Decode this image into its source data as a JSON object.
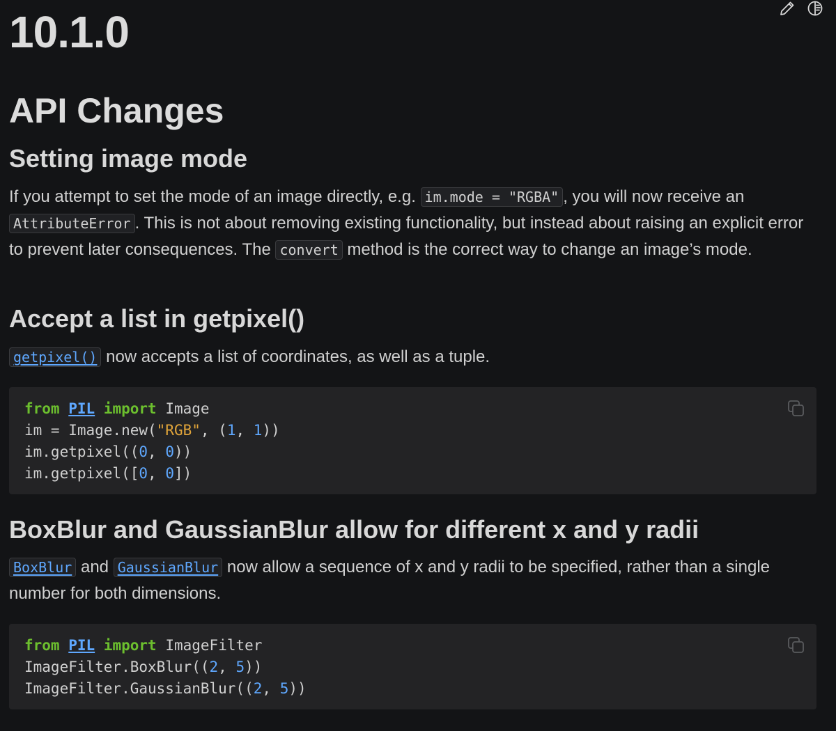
{
  "icons": {
    "edit": "pencil-icon",
    "contents": "contents-circle-icon",
    "copy": "copy-icon"
  },
  "version_title": "10.1.0",
  "section_title": "API Changes",
  "setting_mode": {
    "heading": "Setting image mode",
    "t1": "If you attempt to set the mode of an image directly, e.g. ",
    "c1": "im.mode = \"RGBA\"",
    "t2": ", you will now receive an ",
    "c2": "AttributeError",
    "t3": ". This is not about removing existing functionality, but instead about raising an explicit error to prevent later consequences. The ",
    "c3": "convert",
    "t4": " method is the correct way to change an image’s mode."
  },
  "getpixel": {
    "heading": "Accept a list in getpixel()",
    "c1": "getpixel()",
    "t1": " now accepts a list of coordinates, as well as a tuple.",
    "code": {
      "l1_from": "from",
      "l1_mod": "PIL",
      "l1_import": "import",
      "l1_rest": " Image",
      "l2_a": "im = Image.new(",
      "l2_str": "\"RGB\"",
      "l2_b": ", (",
      "l2_n1": "1",
      "l2_c": ", ",
      "l2_n2": "1",
      "l2_d": "))",
      "l3_a": "im.getpixel((",
      "l3_n1": "0",
      "l3_b": ", ",
      "l3_n2": "0",
      "l3_c": "))",
      "l4_a": "im.getpixel([",
      "l4_n1": "0",
      "l4_b": ", ",
      "l4_n2": "0",
      "l4_c": "])"
    }
  },
  "blur": {
    "heading": "BoxBlur and GaussianBlur allow for different x and y radii",
    "c1": "BoxBlur",
    "t1": " and ",
    "c2": "GaussianBlur",
    "t2": " now allow a sequence of x and y radii to be specified, rather than a single number for both dimensions.",
    "code": {
      "l1_from": "from",
      "l1_mod": "PIL",
      "l1_import": "import",
      "l1_rest": " ImageFilter",
      "l2_a": "ImageFilter.BoxBlur((",
      "l2_n1": "2",
      "l2_b": ", ",
      "l2_n2": "5",
      "l2_c": "))",
      "l3_a": "ImageFilter.GaussianBlur((",
      "l3_n1": "2",
      "l3_b": ", ",
      "l3_n2": "5",
      "l3_c": "))"
    }
  }
}
